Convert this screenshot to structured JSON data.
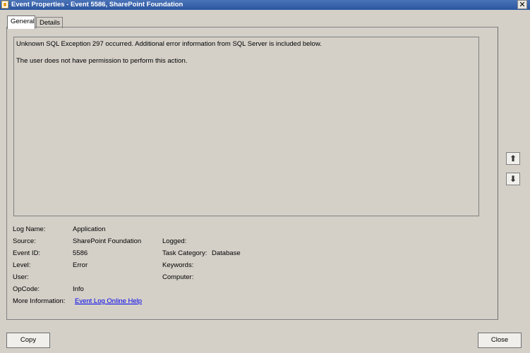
{
  "window": {
    "title": "Event Properties - Event 5586, SharePoint Foundation",
    "close_label": "✕"
  },
  "tabs": [
    {
      "label": "General"
    },
    {
      "label": "Details"
    }
  ],
  "message": {
    "line1": "Unknown SQL Exception 297 occurred. Additional error information from SQL Server is included below.",
    "line2": "The user does not have permission to perform this action."
  },
  "fields": {
    "log_name": {
      "label": "Log Name:",
      "value": "Application"
    },
    "source": {
      "label": "Source:",
      "value": "SharePoint Foundation"
    },
    "logged": {
      "label": "Logged:",
      "value": ""
    },
    "event_id": {
      "label": "Event ID:",
      "value": "5586"
    },
    "task_category": {
      "label": "Task Category:",
      "value": "Database"
    },
    "level": {
      "label": "Level:",
      "value": "Error"
    },
    "keywords": {
      "label": "Keywords:",
      "value": ""
    },
    "user": {
      "label": "User:",
      "value": ""
    },
    "computer": {
      "label": "Computer:",
      "value": ""
    },
    "opcode": {
      "label": "OpCode:",
      "value": "Info"
    },
    "more_info": {
      "label": "More Information:",
      "value": "Event Log Online Help"
    }
  },
  "nav": {
    "up_icon": "arrow-up-icon",
    "down_icon": "arrow-down-icon",
    "up_glyph": "⬆",
    "down_glyph": "⬇"
  },
  "buttons": {
    "copy": "Copy",
    "close": "Close"
  }
}
